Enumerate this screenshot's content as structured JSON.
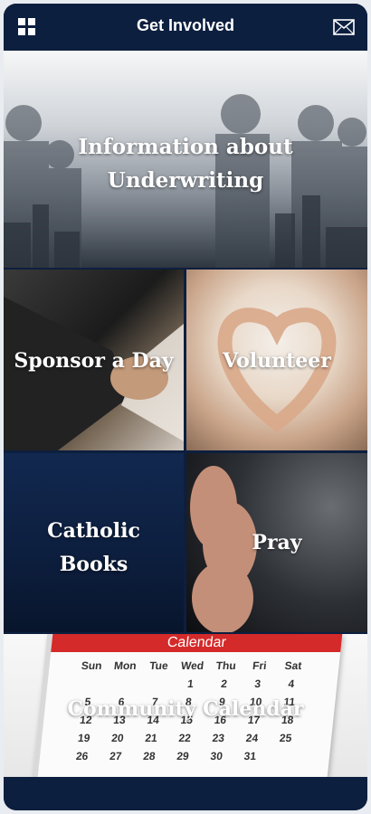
{
  "header": {
    "title": "Get Involved",
    "left_icon": "grid-menu-icon",
    "right_icon": "mail-icon"
  },
  "tiles": {
    "underwriting": {
      "line1": "Information about",
      "line2": "Underwriting"
    },
    "sponsor": {
      "label": "Sponsor a Day"
    },
    "volunteer": {
      "label": "Volunteer"
    },
    "books": {
      "line1": "Catholic",
      "line2": "Books"
    },
    "pray": {
      "label": "Pray"
    },
    "calendar": {
      "label": "Community Calendar"
    }
  },
  "calendar_image": {
    "header": "Calendar",
    "weekdays": [
      "Sun",
      "Mon",
      "Tue",
      "Wed",
      "Thu",
      "Fri",
      "Sat"
    ],
    "rows": [
      [
        "",
        "",
        "",
        "1",
        "2",
        "3",
        "4"
      ],
      [
        "5",
        "6",
        "7",
        "8",
        "9",
        "10",
        "11"
      ],
      [
        "12",
        "13",
        "14",
        "15",
        "16",
        "17",
        "18"
      ],
      [
        "19",
        "20",
        "21",
        "22",
        "23",
        "24",
        "25"
      ],
      [
        "26",
        "27",
        "28",
        "29",
        "30",
        "31",
        ""
      ]
    ]
  },
  "colors": {
    "navy": "#0d1f3f",
    "calendar_red": "#d42a2a"
  }
}
